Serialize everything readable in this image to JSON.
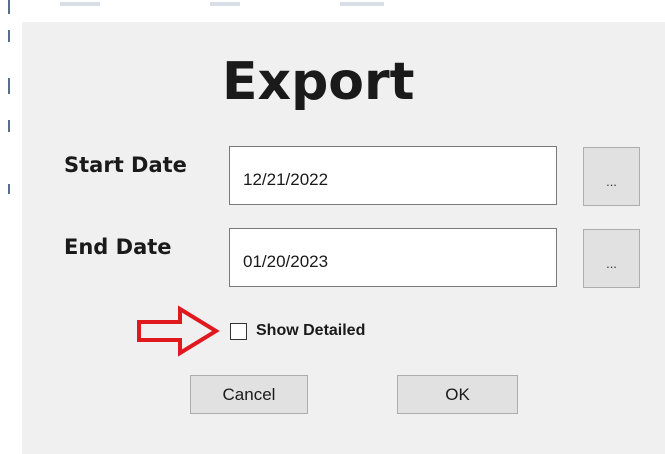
{
  "dialog": {
    "title": "Export",
    "start_date": {
      "label": "Start Date",
      "value": "12/21/2022",
      "picker_label": "..."
    },
    "end_date": {
      "label": "End Date",
      "value": "01/20/2023",
      "picker_label": "..."
    },
    "show_detailed": {
      "label": "Show Detailed",
      "checked": false
    },
    "cancel_label": "Cancel",
    "ok_label": "OK"
  },
  "annotation": {
    "arrow_color": "#e0191f",
    "arrow_icon": "right-arrow-icon"
  }
}
